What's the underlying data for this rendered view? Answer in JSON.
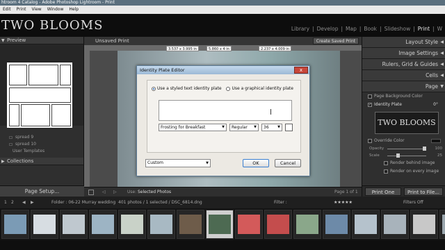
{
  "window": {
    "title": "htroom 4 Catalog - Adobe Photoshop Lightroom - Print"
  },
  "menu": [
    "Edit",
    "Print",
    "View",
    "Window",
    "Help"
  ],
  "identity": {
    "brand": "TWO BLOOMS"
  },
  "modules": [
    "Library",
    "Develop",
    "Map",
    "Book",
    "Slideshow",
    "Print",
    "W"
  ],
  "active_module": "Print",
  "left_panel": {
    "preview_label": "Preview",
    "templates": [
      "spread 9",
      "spread 10"
    ],
    "user_templates_label": "User Templates",
    "collections_label": "Collections",
    "page_setup_label": "Page Setup..."
  },
  "center": {
    "title": "Unsaved Print",
    "create_button": "Create Saved Print",
    "dimensions": [
      "3.537 x 3.995 in",
      "5.860 x 4 in",
      "2.237 x 4.009 in"
    ],
    "toolbar": {
      "use_label": "Use:",
      "use_value": "Selected Photos",
      "page_counter": "Page 1 of 1"
    }
  },
  "dialog": {
    "title": "Identity Plate Editor",
    "close_glyph": "x",
    "styled_option": "Use a styled text identity plate",
    "graphical_option": "Use a graphical identity plate",
    "font": "Frosting for Breakfast",
    "style": "Regular",
    "size": "36",
    "preset": "Custom",
    "ok_label": "OK",
    "cancel_label": "Cancel"
  },
  "right_panel": {
    "sections": [
      "Layout Style",
      "Image Settings",
      "Rulers, Grid & Guides",
      "Cells",
      "Page"
    ],
    "page_bg_label": "Page Background Color",
    "identity_plate_label": "Identity Plate",
    "identity_angle": "0°",
    "identity_text": "TWO BLOOMS",
    "override_color_label": "Override Color",
    "opacity_label": "Opacity",
    "opacity_value": "100",
    "opacity_level": 1.0,
    "scale_label": "Scale",
    "scale_value": "25",
    "scale_level": 0.25,
    "render_behind_label": "Render behind image",
    "render_every_label": "Render on every image",
    "print_one_label": "Print One",
    "print_to_file_label": "Print to File..."
  },
  "filmstrip": {
    "page_numbers": [
      "1",
      "2"
    ],
    "folder_label": "Folder : 06-22 Murray wedding",
    "count_label": "401 photos / 1 selected / DSC_6814.dng",
    "filter_label": "Filter :",
    "filters_off": "Filters Off",
    "stars": "★★★★★",
    "thumb_colors": [
      "#7b9bb5",
      "#d7dde2",
      "#bfc8cf",
      "#9db4c4",
      "#c9d2c8",
      "#a8b9c3",
      "#6e5c4a",
      "#4d6a52",
      "#d35a5a",
      "#c44d4d",
      "#8aa78a",
      "#6d8aa8",
      "#b5c2cc",
      "#a8b3bb",
      "#c8c8c8",
      "#9aa6ad"
    ],
    "selected_index": 7
  }
}
